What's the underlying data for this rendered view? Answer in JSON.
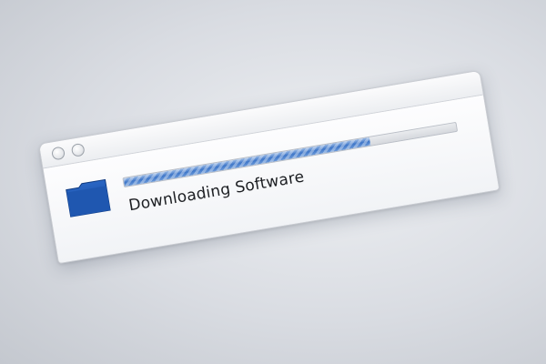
{
  "window": {
    "status_label": "Downloading Software",
    "icon": "folder-icon",
    "progress": 0.74,
    "colors": {
      "progress_fill": "#3f77c9",
      "folder": "#1f57b0"
    }
  }
}
